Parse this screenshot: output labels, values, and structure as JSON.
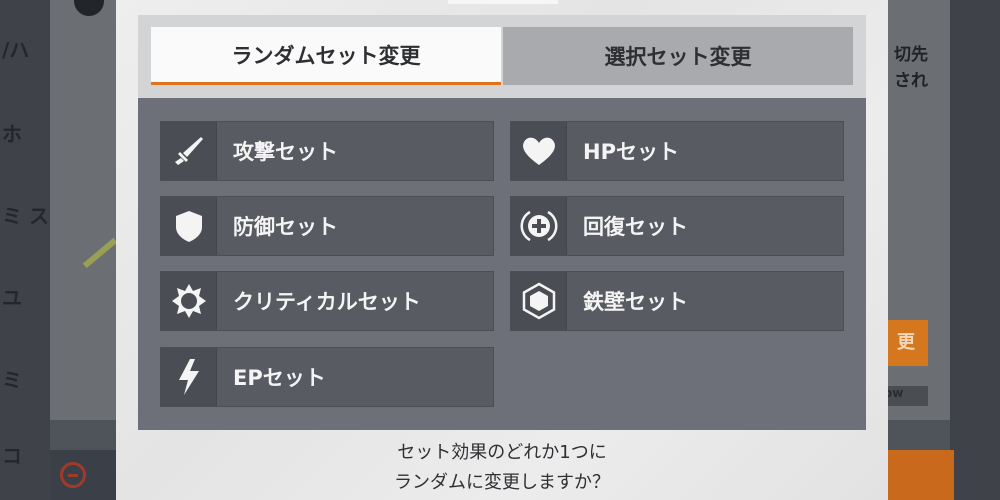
{
  "background": {
    "side_labels": [
      "/ハ",
      "ホ",
      "ミ ス",
      "ユ",
      "ミ",
      "コ"
    ],
    "right_labels": [
      "切先",
      "され"
    ],
    "orange_button_label": "更",
    "small_dark_label": "ow"
  },
  "tabs": [
    {
      "label": "ランダムセット変更",
      "active": true
    },
    {
      "label": "選択セット変更",
      "active": false
    }
  ],
  "options": [
    {
      "label": "攻撃セット",
      "icon": "sword-icon"
    },
    {
      "label": "HPセット",
      "icon": "heart-icon"
    },
    {
      "label": "防御セット",
      "icon": "shield-icon"
    },
    {
      "label": "回復セット",
      "icon": "heal-cross-icon"
    },
    {
      "label": "クリティカルセット",
      "icon": "critical-burst-icon"
    },
    {
      "label": "鉄壁セット",
      "icon": "ironwall-hexagon-icon"
    },
    {
      "label": "EPセット",
      "icon": "lightning-icon"
    }
  ],
  "prompt": {
    "line1": "セット効果のどれか1つに",
    "line2": "ランダムに変更しますか？"
  },
  "colors": {
    "accent": "#e0731e",
    "panel": "#6e7079",
    "option_bg": "#595b63",
    "icon_white": "#f4f4f4"
  }
}
